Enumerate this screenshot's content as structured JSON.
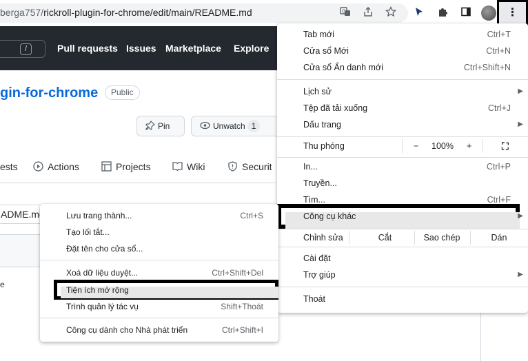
{
  "browser": {
    "url_dim": "berga757/",
    "url_main": "rickroll-plugin-for-chrome/edit/main/README.md",
    "icons": [
      "translate-icon",
      "share-icon",
      "bookmark-star-icon",
      "cursor-extension-icon",
      "puzzle-icon",
      "side-panel-icon",
      "profile-avatar",
      "more-vert-icon"
    ],
    "more_glyph": "⋮"
  },
  "github": {
    "search_key": "/",
    "nav": [
      "Pull requests",
      "Issues",
      "Marketplace",
      "Explore"
    ],
    "repo_name": "gin-for-chrome",
    "visibility": "Public",
    "pin_label": "Pin",
    "unwatch_label": "Unwatch",
    "watch_count": "1",
    "tabs": [
      "ests",
      "Actions",
      "Projects",
      "Wiki",
      "Securit"
    ],
    "file_name": "ADME.md",
    "editor_char": "e"
  },
  "menu": {
    "new_tab": {
      "label": "Tab mới",
      "shortcut": "Ctrl+T"
    },
    "new_window": {
      "label": "Cửa sổ Mới",
      "shortcut": "Ctrl+N"
    },
    "incognito": {
      "label": "Cửa sổ Ẩn danh mới",
      "shortcut": "Ctrl+Shift+N"
    },
    "history": {
      "label": "Lịch sử"
    },
    "downloads": {
      "label": "Tệp đã tải xuống",
      "shortcut": "Ctrl+J"
    },
    "bookmarks": {
      "label": "Dấu trang"
    },
    "zoom": {
      "label": "Thu phóng",
      "minus": "−",
      "value": "100%",
      "plus": "+",
      "fullscreen": "⛶"
    },
    "print": {
      "label": "In...",
      "shortcut": "Ctrl+P"
    },
    "cast": {
      "label": "Truyền..."
    },
    "find": {
      "label": "Tìm...",
      "shortcut": "Ctrl+F"
    },
    "more_tools": {
      "label": "Công cụ khác"
    },
    "edit": {
      "label": "Chỉnh sửa",
      "cut": "Cắt",
      "copy": "Sao chép",
      "paste": "Dán"
    },
    "settings": {
      "label": "Cài đặt"
    },
    "help": {
      "label": "Trợ giúp"
    },
    "exit": {
      "label": "Thoát"
    }
  },
  "submenu": {
    "save_page": {
      "label": "Lưu trang thành...",
      "shortcut": "Ctrl+S"
    },
    "create_shortcut": {
      "label": "Tạo lối tắt..."
    },
    "name_window": {
      "label": "Đặt tên cho cửa sổ..."
    },
    "clear_data": {
      "label": "Xoá dữ liệu duyệt...",
      "shortcut": "Ctrl+Shift+Del"
    },
    "extensions": {
      "label": "Tiện ích mở rộng"
    },
    "task_manager": {
      "label": "Trình quản lý tác vụ",
      "shortcut": "Shift+Thoát"
    },
    "dev_tools": {
      "label": "Công cụ dành cho Nhà phát triển",
      "shortcut": "Ctrl+Shift+I"
    }
  }
}
